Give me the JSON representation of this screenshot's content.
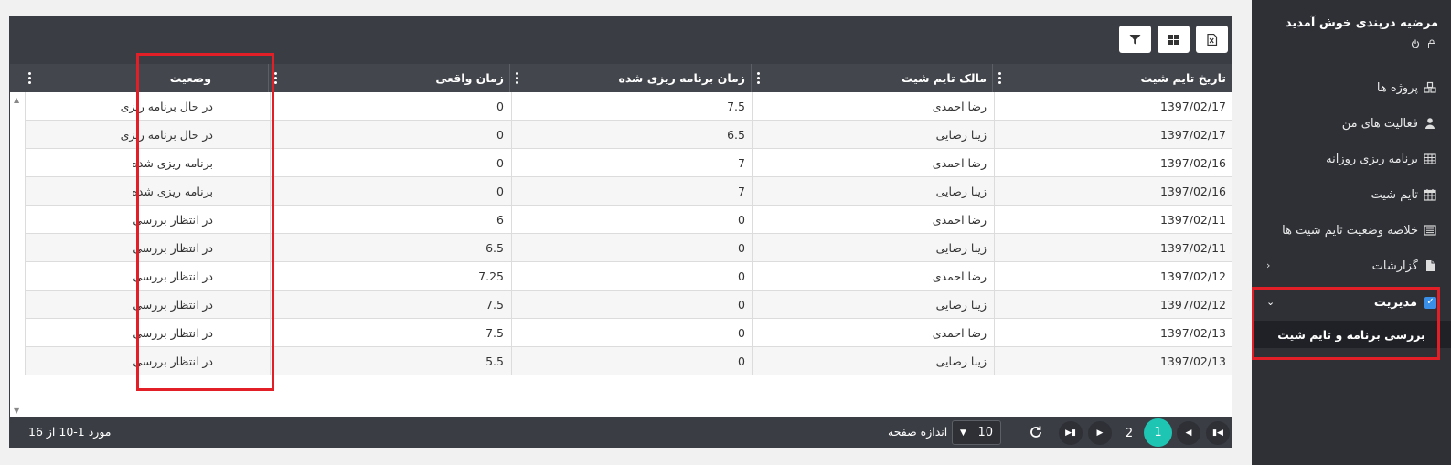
{
  "sidebar": {
    "welcome": "مرضیه درپندی خوش آمدید",
    "menu": [
      {
        "label": "پروژه ها",
        "icon": "cubes-icon"
      },
      {
        "label": "فعالیت های من",
        "icon": "user-tie-icon"
      },
      {
        "label": "برنامه ریزی روزانه",
        "icon": "table-icon"
      },
      {
        "label": "تایم شیت",
        "icon": "calendar-icon"
      },
      {
        "label": "خلاصه وضعیت تایم شیت ها",
        "icon": "list-icon"
      },
      {
        "label": "گزارشات",
        "icon": "file-icon"
      }
    ],
    "management": {
      "title": "مدیریت",
      "submenu": "بررسی برنامه و تایم شیت"
    }
  },
  "grid": {
    "columns": [
      "تاریخ تایم شیت",
      "مالک تایم شیت",
      "زمان برنامه ریزی شده",
      "زمان واقعی",
      "وضعیت"
    ],
    "rows": [
      [
        "1397/02/17",
        "رضا احمدی",
        "7.5",
        "0",
        "در حال برنامه ریزی"
      ],
      [
        "1397/02/17",
        "زیبا رضایی",
        "6.5",
        "0",
        "در حال برنامه ریزی"
      ],
      [
        "1397/02/16",
        "رضا احمدی",
        "7",
        "0",
        "برنامه ریزی شده"
      ],
      [
        "1397/02/16",
        "زیبا رضایی",
        "7",
        "0",
        "برنامه ریزی شده"
      ],
      [
        "1397/02/11",
        "رضا احمدی",
        "0",
        "6",
        "در انتظار بررسی"
      ],
      [
        "1397/02/11",
        "زیبا رضایی",
        "0",
        "6.5",
        "در انتظار بررسی"
      ],
      [
        "1397/02/12",
        "رضا احمدی",
        "0",
        "7.25",
        "در انتظار بررسی"
      ],
      [
        "1397/02/12",
        "زیبا رضایی",
        "0",
        "7.5",
        "در انتظار بررسی"
      ],
      [
        "1397/02/13",
        "رضا احمدی",
        "0",
        "7.5",
        "در انتظار بررسی"
      ],
      [
        "1397/02/13",
        "زیبا رضایی",
        "0",
        "5.5",
        "در انتظار بررسی"
      ]
    ]
  },
  "pager": {
    "pages": [
      "1",
      "2"
    ],
    "active_page": "1",
    "page_size": "10",
    "page_size_label": "اندازه صفحه",
    "summary": "مورد 1-10 از 16"
  },
  "colors": {
    "sidebar_bg": "#2e3036",
    "toolbar_bg": "#3a3d44",
    "accent": "#1fc5b3",
    "highlight": "#e21f26"
  }
}
